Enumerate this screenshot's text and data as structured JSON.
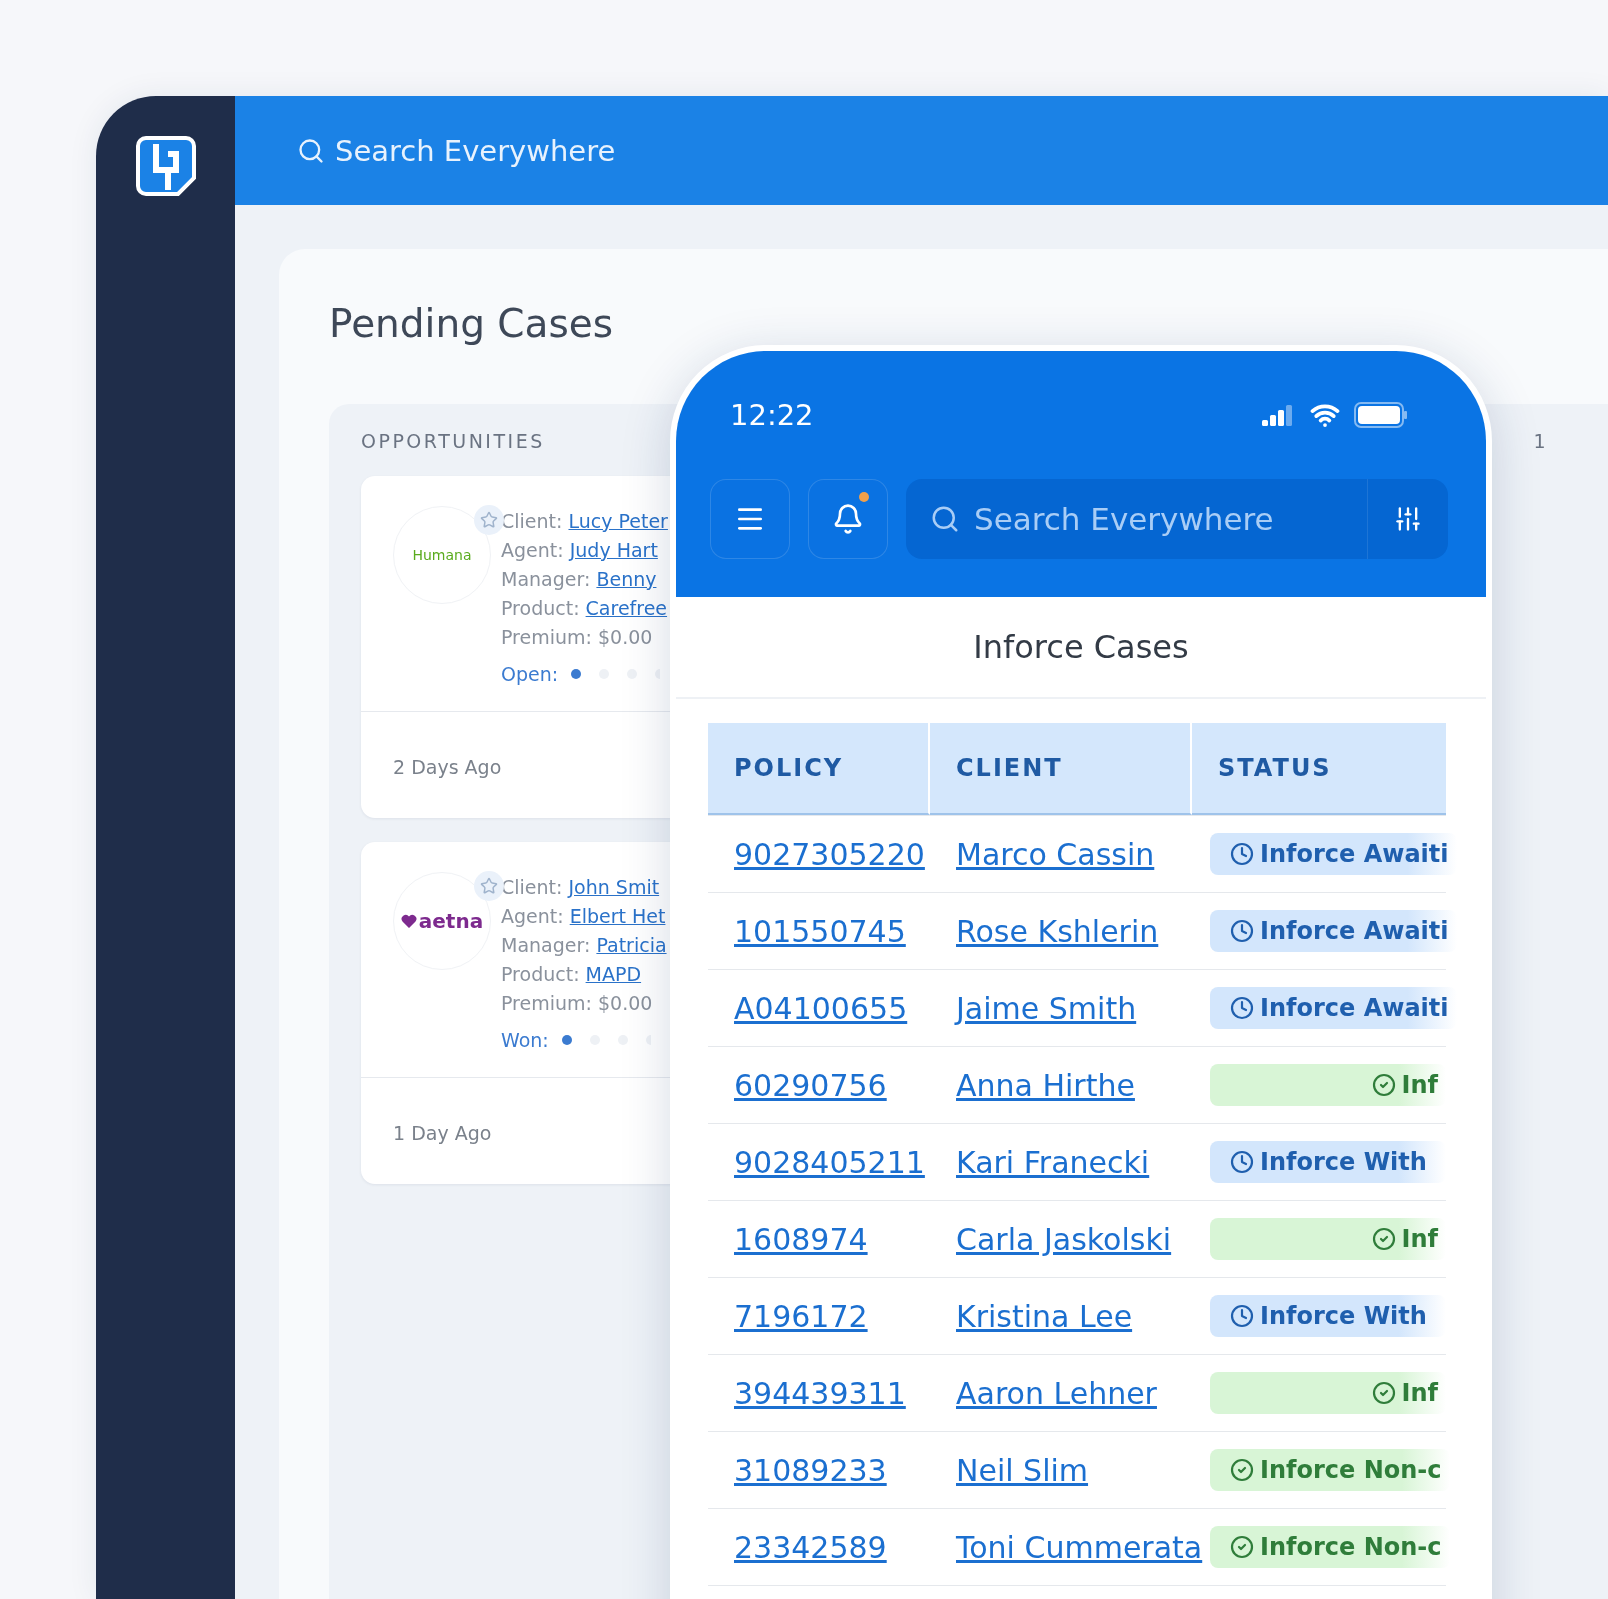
{
  "desktop": {
    "search": {
      "placeholder": "Search Everywhere"
    },
    "title": "Pending Cases",
    "opportunities": {
      "heading": "OPPORTUNITIES",
      "page_indicator": "1",
      "cards": [
        {
          "logo": {
            "kind": "humana",
            "text": "Humana"
          },
          "fields": [
            {
              "label": "Client:",
              "value": "Lucy Peter",
              "link": true
            },
            {
              "label": "Agent:",
              "value": "Judy Hart",
              "link": true
            },
            {
              "label": "Manager:",
              "value": "Benny",
              "link": true
            },
            {
              "label": "Product:",
              "value": "Carefree",
              "link": true
            },
            {
              "label": "Premium:",
              "value": "$0.00",
              "link": false
            }
          ],
          "stage": "Open:",
          "age": "2 Days Ago"
        },
        {
          "logo": {
            "kind": "aetna",
            "text": "aetna"
          },
          "fields": [
            {
              "label": "Client:",
              "value": "John Smit",
              "link": true
            },
            {
              "label": "Agent:",
              "value": "Elbert Het",
              "link": true
            },
            {
              "label": "Manager:",
              "value": "Patricia",
              "link": true
            },
            {
              "label": "Product:",
              "value": "MAPD",
              "link": true
            },
            {
              "label": "Premium:",
              "value": "$0.00",
              "link": false
            }
          ],
          "stage": "Won:",
          "age": "1 Day Ago"
        }
      ]
    }
  },
  "phone": {
    "time": "12:22",
    "unread": true,
    "search": {
      "placeholder": "Search Everywhere"
    },
    "title": "Inforce Cases",
    "table": {
      "columns": [
        "POLICY",
        "CLIENT",
        "STATUS"
      ],
      "rows": [
        {
          "policy": "9027305220",
          "client": "Marco Cassin",
          "status": {
            "kind": "pending",
            "text": "Inforce Awaiti"
          }
        },
        {
          "policy": "101550745",
          "client": "Rose Kshlerin",
          "status": {
            "kind": "pending",
            "text": "Inforce Awaiti"
          }
        },
        {
          "policy": "A04100655",
          "client": "Jaime Smith",
          "status": {
            "kind": "pending",
            "text": "Inforce Awaiti"
          }
        },
        {
          "policy": "60290756",
          "client": "Anna Hirthe",
          "status": {
            "kind": "done",
            "text": "Inf"
          }
        },
        {
          "policy": "9028405211",
          "client": "Kari Franecki",
          "status": {
            "kind": "pending",
            "text": "Inforce With"
          }
        },
        {
          "policy": "1608974",
          "client": "Carla Jaskolski",
          "status": {
            "kind": "done",
            "text": "Inf"
          }
        },
        {
          "policy": "7196172",
          "client": "Kristina Lee",
          "status": {
            "kind": "pending",
            "text": "Inforce With"
          }
        },
        {
          "policy": "394439311",
          "client": "Aaron Lehner",
          "status": {
            "kind": "done",
            "text": "Inf"
          }
        },
        {
          "policy": "31089233",
          "client": "Neil Slim",
          "status": {
            "kind": "done",
            "text": "Inforce Non-c"
          }
        },
        {
          "policy": "23342589",
          "client": "Toni Cummerata",
          "status": {
            "kind": "done",
            "text": "Inforce Non-c"
          }
        }
      ]
    }
  }
}
